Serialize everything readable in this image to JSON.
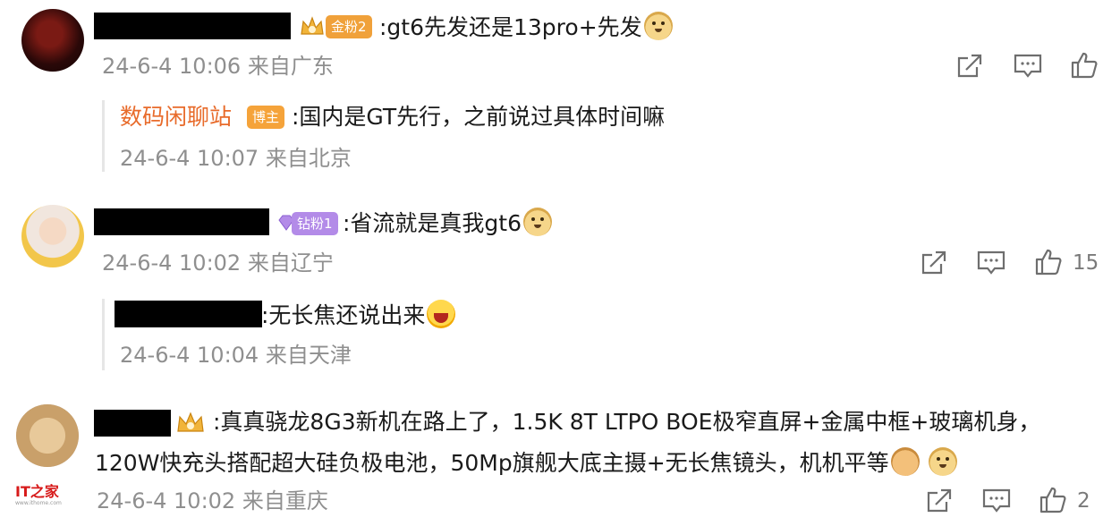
{
  "comments": [
    {
      "badge": "金粉2",
      "text": ":gt6先发还是13pro+先发",
      "meta": "24-6-4 10:06 来自广东",
      "reply": {
        "author": "数码闲聊站",
        "author_badge": "博主",
        "text": ":国内是GT先行，之前说过具体时间嘛",
        "meta": "24-6-4 10:07 来自北京"
      }
    },
    {
      "badge": "钻粉1",
      "text": ":省流就是真我gt6",
      "meta": "24-6-4 10:02 来自辽宁",
      "like_count": "15",
      "reply": {
        "text": ":无长焦还说出来",
        "meta": "24-6-4 10:04 来自天津"
      }
    },
    {
      "text_line1": ":真真骁龙8G3新机在路上了，1.5K 8T LTPO BOE极窄直屏+金属中框+玻璃机身，",
      "text_line2": "120W快充头搭配超大硅负极电池，50Mp旗舰大底主摄+无长焦镜头，机机平等",
      "meta": "24-6-4 10:02 来自重庆",
      "like_count": "2"
    }
  ],
  "watermark": {
    "logo": "IT之家",
    "url": "www.ithome.com"
  },
  "colors": {
    "text": "#1a1a1a",
    "meta": "#8f8f8f",
    "author_link": "#e86b2b",
    "gold_badge": "#f0a13a",
    "purple_badge": "#b38be8",
    "blogger_badge": "#f5a33a",
    "icon": "#6e6e6e"
  }
}
